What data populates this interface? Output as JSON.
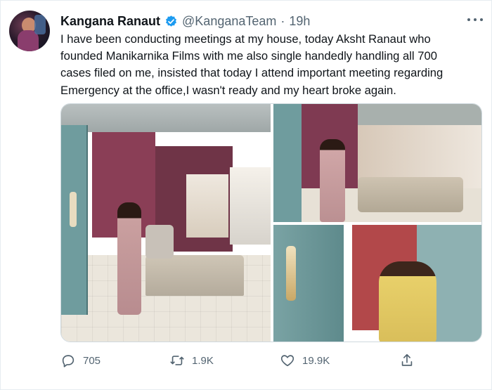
{
  "tweet": {
    "author_name": "Kangana Ranaut",
    "handle": "@KanganaTeam",
    "separator": "·",
    "time": "19h",
    "text": "I have been conducting meetings at my house, today Aksht Ranaut who\nfounded Manikarnika Films with me also single handedly handling all 700\ncases filed on me, insisted that today I attend important meeting regarding\nEmergency at the office,I wasn't ready and my heart broke again.",
    "verified_color": "#1d9bf0",
    "actions": {
      "reply_count": "705",
      "retweet_count": "1.9K",
      "like_count": "19.9K"
    },
    "icons": {
      "avatar": "avatar-photo",
      "verified": "verified-badge-icon",
      "more": "more-options-icon",
      "reply": "reply-icon",
      "retweet": "retweet-icon",
      "like": "heart-icon",
      "share": "share-icon"
    }
  }
}
